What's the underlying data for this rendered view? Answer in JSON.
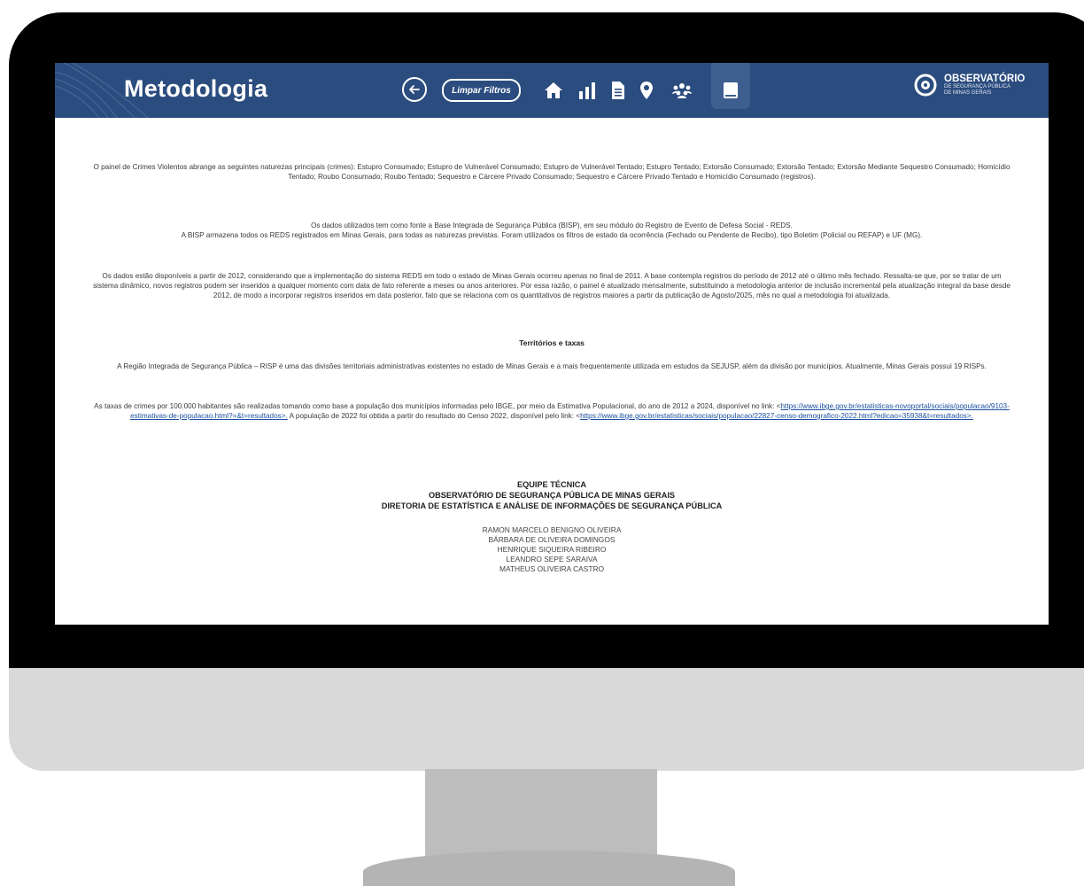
{
  "header": {
    "page_title": "Metodologia",
    "clear_filters_label": "Limpar Filtros",
    "nav_icons": [
      "back-arrow-icon",
      "home-icon",
      "bar-chart-icon",
      "document-icon",
      "map-pin-icon",
      "group-icon",
      "book-icon"
    ],
    "logo": {
      "title": "OBSERVATÓRIO",
      "subtitle_line1": "DE SEGURANÇA PÚBLICA",
      "subtitle_line2": "DE MINAS GERAIS"
    },
    "colors": {
      "bar": "#2b4c7e",
      "active": "#3d5f8f"
    }
  },
  "content": {
    "p1": "O painel de Crimes Violentos abrange as seguintes naturezas principais (crimes): Estupro Consumado; Estupro de Vulnerável Consumado; Estupro de Vulnerável Tentado; Estupro Tentado; Extorsão Consumado; Extorsão Tentado; Extorsão Mediante Sequestro Consumado; Homicídio Tentado; Roubo Consumado; Roubo Tentado; Sequestro e Cárcere Privado Consumado; Sequestro e Cárcere Privado Tentado e Homicídio Consumado (registros).",
    "p2a": "Os dados utilizados tem como fonte a Base Integrada de Segurança Pública (BISP), em seu módulo do Registro de Evento de Defesa Social - REDS.",
    "p2b": "A BISP armazena todos os REDS registrados em Minas Gerais, para todas as naturezas previstas. Foram utilizados os filtros de estado da ocorrência (Fechado ou Pendente de Recibo), tipo Boletim (Policial ou REFAP) e UF (MG).",
    "p3": "Os dados estão disponíveis a partir de 2012, considerando que a implementação do sistema REDS em todo o estado de Minas Gerais ocorreu apenas no final de 2011. A base contempla registros do período de 2012 até o último mês fechado. Ressalta-se que, por se tratar de um sistema dinâmico, novos registros podem ser inseridos a qualquer momento com data de fato referente a meses ou anos anteriores. Por essa razão, o painel é atualizado mensalmente, substituindo a metodologia anterior de inclusão incremental pela atualização integral da base desde 2012, de modo a incorporar registros inseridos em data posterior, fato que se relaciona com os quantitativos de registros maiores a partir da publicação de Agosto/2025, mês no qual a metodologia foi atualizada.",
    "section_heading": "Territórios e taxas",
    "p4": "A Região Integrada de Segurança Pública – RISP é uma das divisões territoriais administrativas existentes no estado de Minas Gerais e a mais frequentemente utilizada em estudos da SEJUSP, além da divisão por municípios. Atualmente, Minas Gerais possui 19 RISPs.",
    "p5_start": "As taxas de crimes por 100.000 habitantes são realizadas tomando como base a população dos municípios informadas pelo IBGE, por meio da Estimativa Populacional, do ano de 2012 a 2024, disponível no link: <",
    "p5_link1": "https://www.ibge.gov.br/estatisticas-novoportal/sociais/populacao/9103-estimativas-de-populacao.html?=&t=resultados>.",
    "p5_mid": " A população de 2022 foi obtida a partir do resultado do Censo 2022, disponível pelo link: <",
    "p5_link2": "https://www.ibge.gov.br/estatisticas/sociais/populacao/22827-censo-demografico-2022.html?edicao=35938&t=resultados>."
  },
  "team": {
    "title": "EQUIPE TÉCNICA",
    "org": "OBSERVATÓRIO DE SEGURANÇA PÚBLICA DE MINAS GERAIS",
    "dept": "DIRETORIA DE ESTATÍSTICA E ANÁLISE DE INFORMAÇÕES DE SEGURANÇA PÚBLICA",
    "members": [
      "RAMON MARCELO BENIGNO OLIVEIRA",
      "BÁRBARA DE OLIVEIRA DOMINGOS",
      "HENRIQUE SIQUEIRA RIBEIRO",
      "LEANDRO SEPE SARAIVA",
      "MATHEUS OLIVEIRA CASTRO"
    ]
  }
}
